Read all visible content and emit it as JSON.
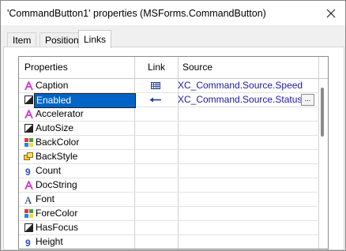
{
  "window": {
    "title": "'CommandButton1' properties (MSForms.CommandButton)"
  },
  "tabs": [
    {
      "label": "Item",
      "active": false
    },
    {
      "label": "Position",
      "active": false
    },
    {
      "label": "Links",
      "active": true
    }
  ],
  "grid": {
    "headers": {
      "properties": "Properties",
      "link": "Link",
      "source": "Source"
    },
    "rows": [
      {
        "name": "Caption",
        "icon": "text-a-icon",
        "link": "link-grid-icon",
        "source": "XC_Command.Source.Speed"
      },
      {
        "name": "Enabled",
        "icon": "boolean-icon",
        "link": "link-arrow-icon",
        "source": "XC_Command.Source.Status",
        "selected": true,
        "has_ellipsis": true
      },
      {
        "name": "Accelerator",
        "icon": "text-a-icon",
        "link": "",
        "source": ""
      },
      {
        "name": "AutoSize",
        "icon": "boolean-icon",
        "link": "",
        "source": ""
      },
      {
        "name": "BackColor",
        "icon": "color-icon",
        "link": "",
        "source": ""
      },
      {
        "name": "BackStyle",
        "icon": "style-icon",
        "link": "",
        "source": ""
      },
      {
        "name": "Count",
        "icon": "number-icon",
        "link": "",
        "source": ""
      },
      {
        "name": "DocString",
        "icon": "text-a-icon",
        "link": "",
        "source": ""
      },
      {
        "name": "Font",
        "icon": "font-icon",
        "link": "",
        "source": ""
      },
      {
        "name": "ForeColor",
        "icon": "color-icon",
        "link": "",
        "source": ""
      },
      {
        "name": "HasFocus",
        "icon": "boolean-icon",
        "link": "",
        "source": ""
      },
      {
        "name": "Height",
        "icon": "number-icon",
        "link": "",
        "source": ""
      }
    ],
    "ellipsis_label": "..."
  },
  "colors": {
    "selection": "#0063c5",
    "source_text": "#1a1aa6"
  }
}
